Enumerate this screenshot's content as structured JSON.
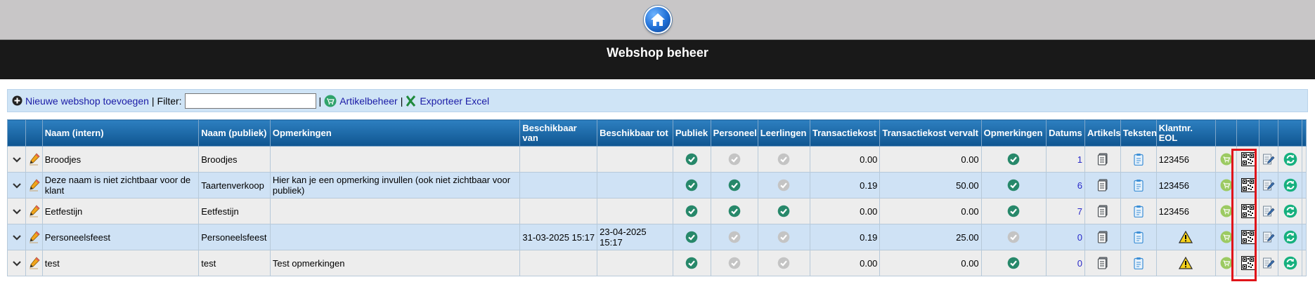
{
  "page": {
    "title": "Webshop beheer"
  },
  "toolbar": {
    "add_label": "Nieuwe webshop toevoegen",
    "sep1": "|",
    "filter_label": "Filter:",
    "filter_value": "",
    "sep2": "|",
    "articles_label": "Artikelbeheer",
    "sep3": "|",
    "export_label": "Exporteer Excel"
  },
  "table": {
    "headers": {
      "name_internal": "Naam (intern)",
      "name_public": "Naam (publiek)",
      "remarks": "Opmerkingen",
      "available_from": "Beschikbaar van",
      "available_to": "Beschikbaar tot",
      "public": "Publiek",
      "staff": "Personeel",
      "students": "Leerlingen",
      "transaction_cost": "Transactiekost",
      "transaction_cost_expired": "Transactiekost vervalt",
      "remarks2": "Opmerkingen",
      "dates": "Datums",
      "articles": "Artikels",
      "texts": "Teksten",
      "customer_eol": "Klantnr. EOL"
    },
    "rows": [
      {
        "name_internal": "Broodjes",
        "name_public": "Broodjes",
        "remarks": "",
        "from": "",
        "to": "",
        "public": "on",
        "staff": "off",
        "students": "off",
        "cost": "0.00",
        "cost_expired": "0.00",
        "remarks_flag": "on",
        "dates": "1",
        "customer": "123456",
        "customer_warning": false
      },
      {
        "name_internal": "Deze naam is niet zichtbaar voor de klant",
        "name_public": "Taartenverkoop",
        "remarks": "Hier kan je een opmerking invullen (ook niet zichtbaar voor publiek)",
        "from": "",
        "to": "",
        "public": "on",
        "staff": "on",
        "students": "off",
        "cost": "0.19",
        "cost_expired": "50.00",
        "remarks_flag": "on",
        "dates": "6",
        "customer": "123456",
        "customer_warning": false
      },
      {
        "name_internal": "Eetfestijn",
        "name_public": "Eetfestijn",
        "remarks": "",
        "from": "",
        "to": "",
        "public": "on",
        "staff": "on",
        "students": "on",
        "cost": "0.00",
        "cost_expired": "0.00",
        "remarks_flag": "on",
        "dates": "7",
        "customer": "123456",
        "customer_warning": false
      },
      {
        "name_internal": "Personeelsfeest",
        "name_public": "Personeelsfeest",
        "remarks": "",
        "from": "31-03-2025 15:17",
        "to": "23-04-2025 15:17",
        "public": "on",
        "staff": "off",
        "students": "off",
        "cost": "0.19",
        "cost_expired": "25.00",
        "remarks_flag": "off",
        "dates": "0",
        "customer": "",
        "customer_warning": true
      },
      {
        "name_internal": "test",
        "name_public": "test",
        "remarks": "Test opmerkingen",
        "from": "",
        "to": "",
        "public": "on",
        "staff": "off",
        "students": "off",
        "cost": "0.00",
        "cost_expired": "0.00",
        "remarks_flag": "on",
        "dates": "0",
        "customer": "",
        "customer_warning": true
      }
    ]
  },
  "colors": {
    "header_top": "#2d7fc0",
    "header_bottom": "#0f5590",
    "row_odd": "#ededed",
    "row_even": "#cfe2f5",
    "check_on": "#27886a",
    "check_off": "#c4c4c4",
    "highlight": "#e0141a"
  }
}
